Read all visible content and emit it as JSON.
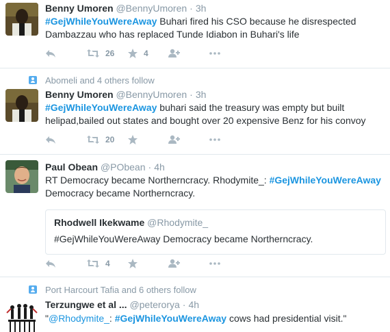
{
  "tweets": [
    {
      "name": "Benny Umoren",
      "handle": "@BennyUmoren",
      "time": "3h",
      "text_hashtag": "#GejWhileYouWereAway",
      "text_rest": " Buhari fired his CSO because he disrespected Dambazzau who has replaced Tunde Idiabon in Buhari's life",
      "retweets": "26",
      "likes": "4"
    },
    {
      "context": "Abomeli and 4 others follow",
      "name": "Benny Umoren",
      "handle": "@BennyUmoren",
      "time": "3h",
      "text_hashtag": "#GejWhileYouWereAway",
      "text_rest": " buhari said the treasury was empty but built helipad,bailed out states and bought over 20 expensive Benz for his convoy",
      "retweets": "20",
      "likes": ""
    },
    {
      "name": "Paul Obean",
      "handle": "@PObean",
      "time": "4h",
      "text_before": "RT Democracy became Northerncracy. Rhodymite_: ",
      "text_hashtag": "#GejWhileYouWereAway",
      "text_after": " Democracy became Northerncracy.",
      "quote": {
        "name": "Rhodwell Ikekwame",
        "handle": "@Rhodymite_",
        "text": "#GejWhileYouWereAway Democracy became Northerncracy."
      },
      "retweets": "4",
      "likes": ""
    },
    {
      "context": "Port Harcourt Tafia and 6 others follow",
      "name": "Terzungwe et al ...",
      "handle": "@peterorya",
      "time": "4h",
      "text_open": "\"",
      "text_mention": "@Rhodymite_",
      "text_mid": ": ",
      "text_hashtag": "#GejWhileYouWereAway",
      "text_rest": " cows had presidential visit.\""
    }
  ],
  "colors": {
    "link": "#1b95e0",
    "muted": "#8899a6",
    "text": "#292f33",
    "divider": "#e1e8ed"
  },
  "icons": [
    "reply-icon",
    "retweet-icon",
    "like-star-icon",
    "follow-icon",
    "more-icon",
    "follow-context-icon"
  ]
}
